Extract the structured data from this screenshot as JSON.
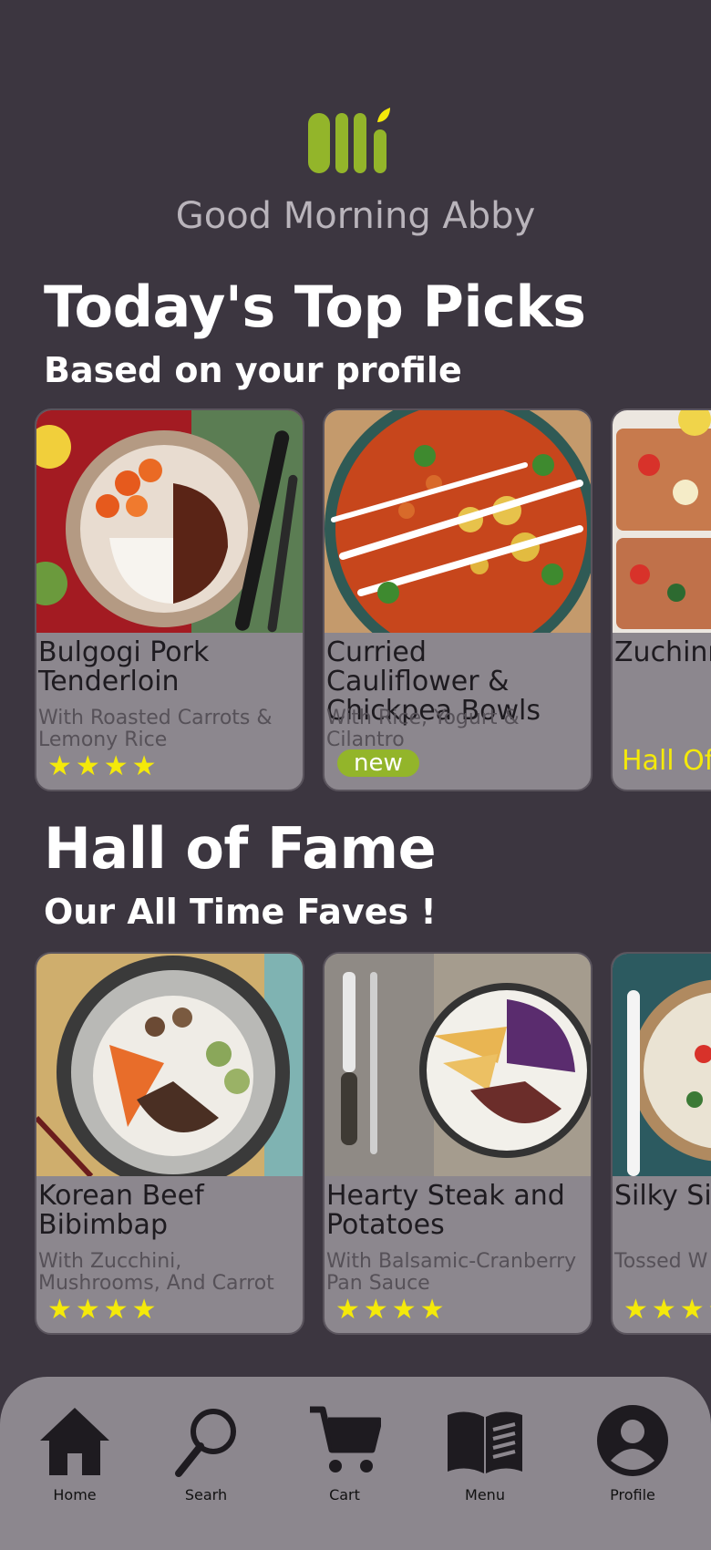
{
  "colors": {
    "background": "#3c3640",
    "card": "#8c878e",
    "brand": "#93b52a",
    "star": "#f4e90a"
  },
  "logo": {
    "text": "olli",
    "icon": "olli-logo"
  },
  "greeting": "Good Morning Abby",
  "top_picks": {
    "title": "Today's Top Picks",
    "subtitle": "Based on your profile",
    "cards": [
      {
        "name": "Bulgogi Pork Tenderloin",
        "desc": "With Roasted Carrots & Lemony Rice",
        "stars": "★★★★",
        "rating": 4
      },
      {
        "name": "Curried Cauliflower & Chickpea Bowls",
        "desc": "With Rice, Yogurt & Cilantro",
        "badge": "new"
      },
      {
        "name": "Zuchinn Flatbrea",
        "tag": "Hall Of"
      }
    ]
  },
  "hall_of_fame": {
    "title": "Hall of Fame",
    "subtitle": "Our All Time Faves !",
    "cards": [
      {
        "name": "Korean Beef Bibimbap",
        "desc": "With Zucchini, Mushrooms, And Carrot",
        "stars": "★★★★",
        "rating": 4
      },
      {
        "name": "Hearty Steak and Potatoes",
        "desc": "With Balsamic-Cranberry Pan Sauce",
        "stars": "★★★★",
        "rating": 4
      },
      {
        "name": "Silky Sid Shrimp",
        "desc": "Tossed W Zucchini &",
        "stars": "★★★★",
        "rating": 4
      }
    ]
  },
  "nav": [
    {
      "label": "Home",
      "icon": "home-icon"
    },
    {
      "label": "Searh",
      "icon": "search-icon"
    },
    {
      "label": "Cart",
      "icon": "cart-icon"
    },
    {
      "label": "Menu",
      "icon": "menu-book-icon"
    },
    {
      "label": "Profile",
      "icon": "profile-icon"
    }
  ]
}
